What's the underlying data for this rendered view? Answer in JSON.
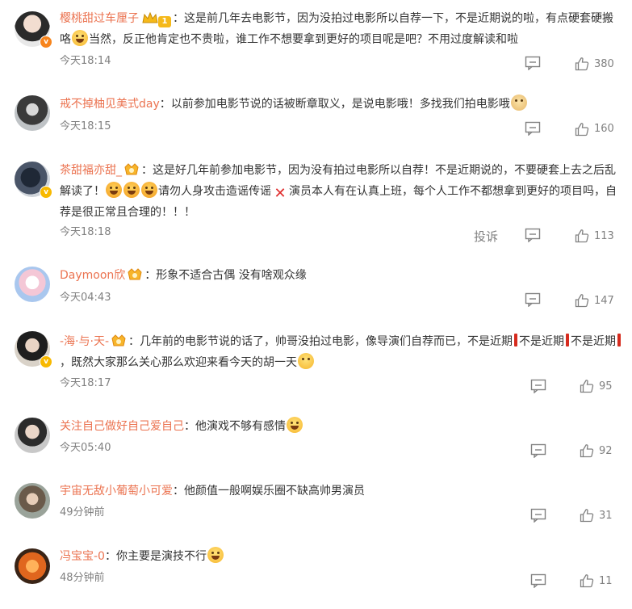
{
  "comments": [
    {
      "username": "樱桃甜过车厘子",
      "colon": "：",
      "level": "1",
      "text_a": "这是前几年去电影节，因为没拍过电影所以自荐一下，不是近期说的啦，有点硬套硬搬咯",
      "text_b": "当然，反正他肯定也不贵啦，谁工作不想要拿到更好的项目呢是吧？不用过度解读和啦",
      "time": "今天18:14",
      "likes": "380"
    },
    {
      "username": "戒不掉柚见美式day",
      "colon": "：",
      "text_a": "以前参加电影节说的话被断章取义，是说电影哦！多找我们拍电影哦",
      "time": "今天18:15",
      "likes": "160"
    },
    {
      "username": "茶甜福亦甜_",
      "colon": "：",
      "text_a": "这是好几年前参加电影节，因为没有拍过电影所以自荐！不是近期说的，不要硬套上去之后乱解读了！",
      "text_b": "请勿人身攻击造谣传谣",
      "text_c": "演员本人有在认真上班，每个人工作不都想拿到更好的项目吗，自荐是很正常且合理的！！！",
      "time": "今天18:18",
      "report": "投诉",
      "likes": "113"
    },
    {
      "username": "Daymoon欣",
      "colon": "：",
      "text_a": "形象不适合古偶 没有啥观众缘",
      "time": "今天04:43",
      "likes": "147"
    },
    {
      "username": "-海·与·天-",
      "colon": "：",
      "text_a": "几年前的电影节说的话了，帅哥没拍过电影，像导演们自荐而已，不是近期",
      "text_b": "不是近期",
      "text_c": "不是近期",
      "text_d": "，既然大家那么关心那么欢迎来看今天的胡一天",
      "time": "今天18:17",
      "likes": "95"
    },
    {
      "username": "关注自己做好自己爱自己",
      "colon": "：",
      "text_a": "他演戏不够有感情",
      "time": "今天05:40",
      "likes": "92"
    },
    {
      "username": "宇宙无敌小葡萄小可爱",
      "colon": "：",
      "text_a": "他颜值一般啊娱乐圈不缺高帅男演员",
      "time": "49分钟前",
      "likes": "31"
    },
    {
      "username": "冯宝宝-0",
      "colon": "：",
      "text_a": "你主要是演技不行",
      "time": "48分钟前",
      "likes": "11"
    }
  ],
  "icons": {
    "reply": "comment-reply-icon",
    "like": "thumbs-up-icon"
  },
  "colors": {
    "username": "#eb7350",
    "text": "#333333",
    "meta": "#808080"
  }
}
